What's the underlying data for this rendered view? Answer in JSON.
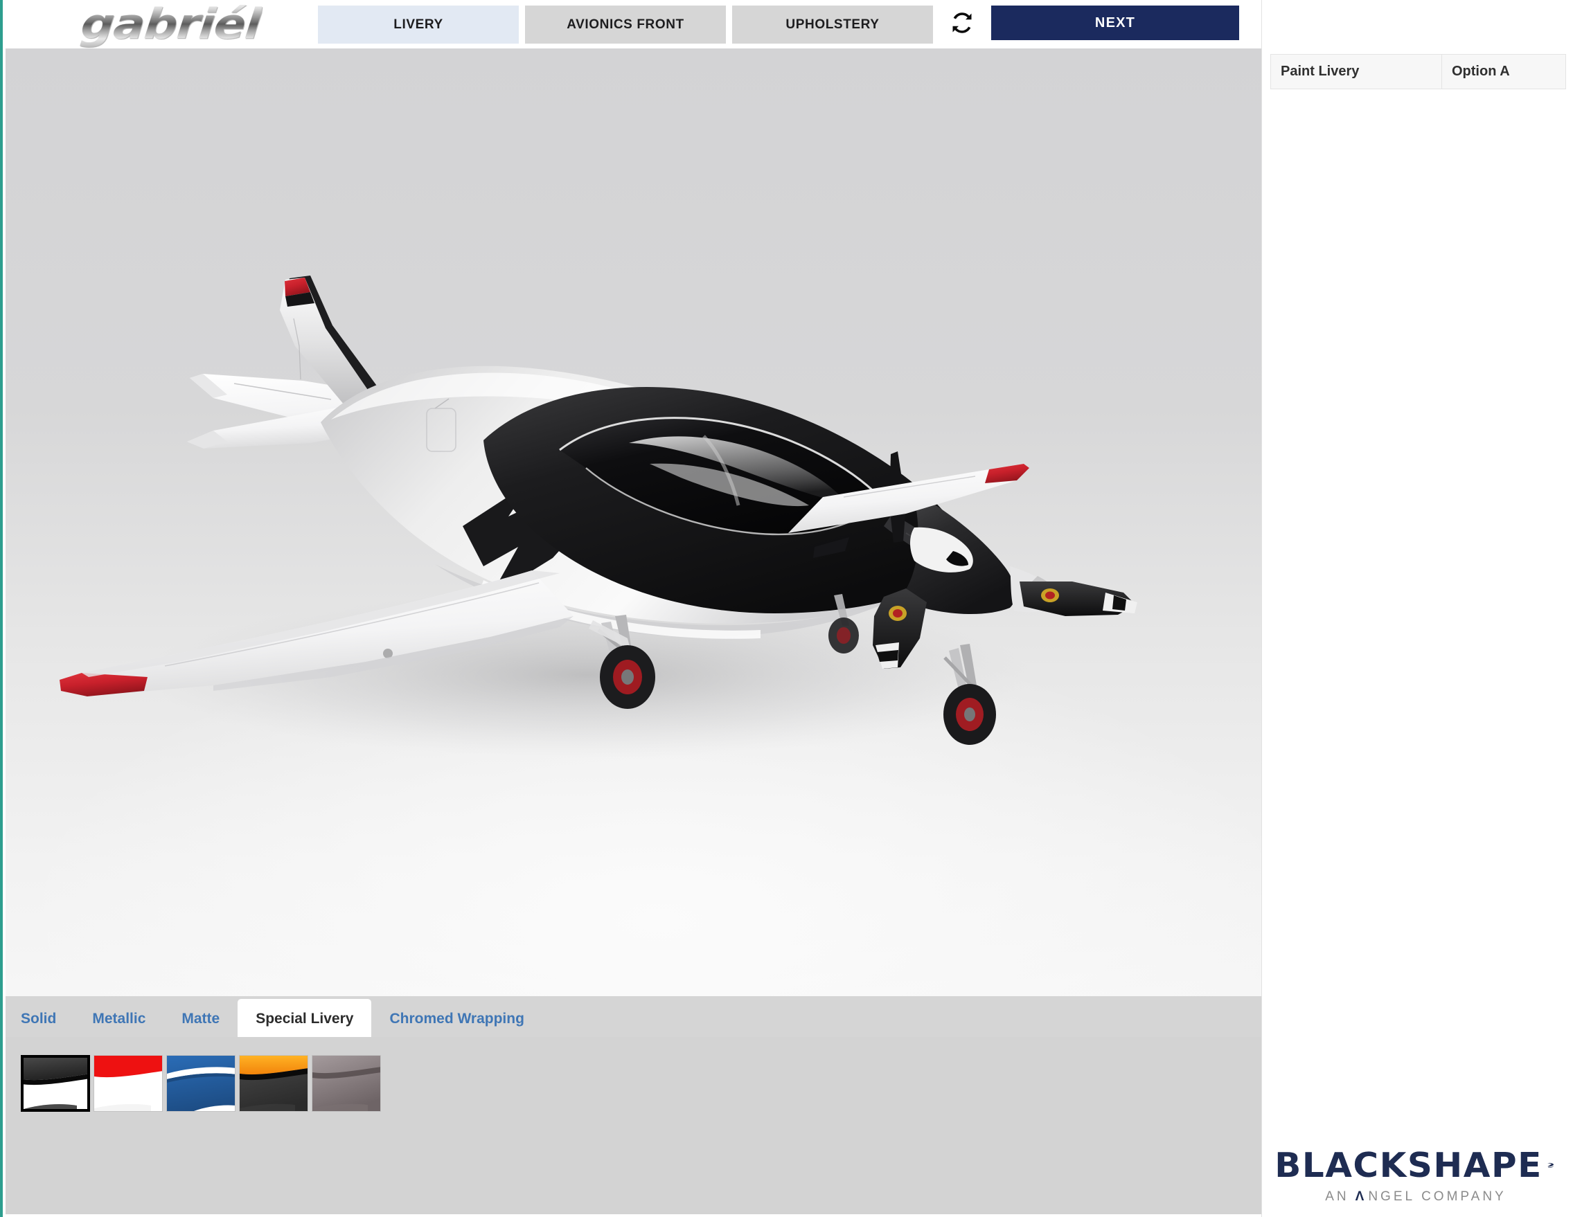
{
  "brand": {
    "logo_text": "gabriél"
  },
  "header": {
    "tabs": [
      {
        "label": "LIVERY",
        "active": true
      },
      {
        "label": "AVIONICS FRONT",
        "active": false
      },
      {
        "label": "UPHOLSTERY",
        "active": false
      }
    ],
    "refresh_icon": "refresh-icon",
    "next_label": "NEXT"
  },
  "summary": {
    "rows": [
      {
        "label": "Paint Livery",
        "value": "Option A"
      }
    ]
  },
  "finish": {
    "tabs": [
      {
        "label": "Solid",
        "active": false
      },
      {
        "label": "Metallic",
        "active": false
      },
      {
        "label": "Matte",
        "active": false
      },
      {
        "label": "Special Livery",
        "active": true
      },
      {
        "label": "Chromed Wrapping",
        "active": false
      }
    ]
  },
  "swatches": [
    {
      "name": "black-white-livery",
      "selected": true,
      "top": "#3b3b3b",
      "stripe": "#111111",
      "bottom": "#ffffff"
    },
    {
      "name": "red-white-livery",
      "selected": false,
      "top": "#ee1111",
      "stripe": "#ffffff",
      "bottom": "#ffffff"
    },
    {
      "name": "blue-white-livery",
      "selected": false,
      "top": "#1f5fa8",
      "stripe": "#ffffff",
      "bottom": "#21548f"
    },
    {
      "name": "orange-grey-livery",
      "selected": false,
      "top": "#f79512",
      "stripe": "#111111",
      "bottom": "#3e3e3e"
    },
    {
      "name": "taupe-livery",
      "selected": false,
      "top": "#8e8486",
      "stripe": "#5a5052",
      "bottom": "#766c6e"
    }
  ],
  "footer": {
    "logo_name": "BLACKSHAPE",
    "tagline_prefix": "AN",
    "tagline_brand": "NGEL",
    "tagline_suffix": "COMPANY"
  },
  "colors": {
    "accent_navy": "#1b2a5e",
    "tab_active": "#e2e9f3",
    "tab_inactive": "#d6d6d6",
    "link_blue": "#3f76b5",
    "edge_teal": "#2e9e8f",
    "livery_red": "#c8102e",
    "viewport_bg": "#d5d5d7"
  },
  "render": {
    "subject": "single-engine propeller aircraft",
    "fuselage_white": "#f0f0f0",
    "fuselage_silver": "#bcbcbe",
    "accent_black": "#1a1a1a",
    "tip_red": "#c8222c",
    "canopy_black": "#0d0d0d"
  }
}
